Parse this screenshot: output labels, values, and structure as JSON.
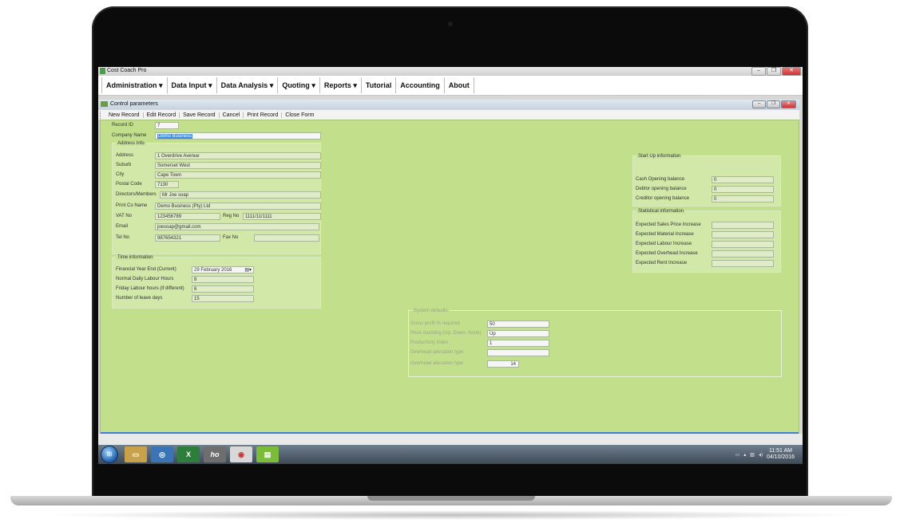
{
  "app": {
    "title": "Cost Coach Pro"
  },
  "menu": {
    "items": [
      "Administration",
      "Data Input",
      "Data Analysis",
      "Quoting",
      "Reports",
      "Tutorial",
      "Accounting",
      "About"
    ]
  },
  "child_window": {
    "title": "Control parameters"
  },
  "toolbar": {
    "buttons": [
      "New Record",
      "Edit Record",
      "Save Record",
      "Cancel",
      "Print Record",
      "Close Form"
    ]
  },
  "form": {
    "record_id": {
      "label": "Record ID",
      "value": "7"
    },
    "company_name": {
      "label": "Company Name",
      "value": "Demo Business"
    },
    "address_info": {
      "title": "Address Info",
      "address": {
        "label": "Address",
        "value": "1 Overdrive Avenue"
      },
      "suburb": {
        "label": "Suburb",
        "value": "Somerset West"
      },
      "city": {
        "label": "City",
        "value": "Cape Town"
      },
      "postal_code": {
        "label": "Postal Code",
        "value": "7130"
      },
      "directors": {
        "label": "Directors/Members",
        "value": "Mr Joe soap"
      },
      "print_co_name": {
        "label": "Print Co Name",
        "value": "Demo Business (Pty) Ltd"
      },
      "vat_no": {
        "label": "VAT No",
        "value": "123456789"
      },
      "reg_no": {
        "label": "Reg No",
        "value": "1111/11/1111"
      },
      "email": {
        "label": "Email",
        "value": "joesoap@gmail.com"
      },
      "tel_no": {
        "label": "Tel No",
        "value": "987654321"
      },
      "fax_no": {
        "label": "Fax No",
        "value": ""
      }
    },
    "time_info": {
      "title": "Time information",
      "fin_year_end": {
        "label": "Financial Year End (Current)",
        "value": "29  February  2016"
      },
      "daily_hours": {
        "label": "Normal Daily Labour Hours",
        "value": "8"
      },
      "friday_hours": {
        "label": "Friday Labour hours (if different)",
        "value": "6"
      },
      "leave_days": {
        "label": "Number of leave days",
        "value": "15"
      }
    },
    "startup_info": {
      "title": "Start Up information",
      "cash_opening": {
        "label": "Cash Opening balance",
        "value": "0"
      },
      "debtor_opening": {
        "label": "Debtor opening balance",
        "value": "0"
      },
      "creditor_opening": {
        "label": "Creditor opening balance",
        "value": "0"
      }
    },
    "statistical_info": {
      "title": "Statistical information",
      "sales_price": {
        "label": "Expected Sales Price Increase",
        "value": ""
      },
      "material": {
        "label": "Expected Material Increase",
        "value": ""
      },
      "labour": {
        "label": "Expected Labour Increase",
        "value": ""
      },
      "overhead": {
        "label": "Expected Overhead Increase",
        "value": ""
      },
      "rent": {
        "label": "Expected Rent Increase",
        "value": ""
      }
    },
    "system_defaults": {
      "title": "System defaults",
      "gross_profit": {
        "label": "Gross profit % required",
        "value": "50"
      },
      "price_rounding": {
        "label": "Price rounding (Up, Down, None)",
        "value": "Up"
      },
      "productivity": {
        "label": "Productivity Index",
        "value": "1"
      },
      "overhead_type_1": {
        "label": "Overhead allocation type",
        "value": ""
      },
      "overhead_type_2": {
        "label": "Overhead allocation type",
        "value": "14"
      }
    }
  },
  "taskbar": {
    "apps": [
      "ho"
    ],
    "time": "11:51 AM",
    "date": "04/10/2016"
  }
}
